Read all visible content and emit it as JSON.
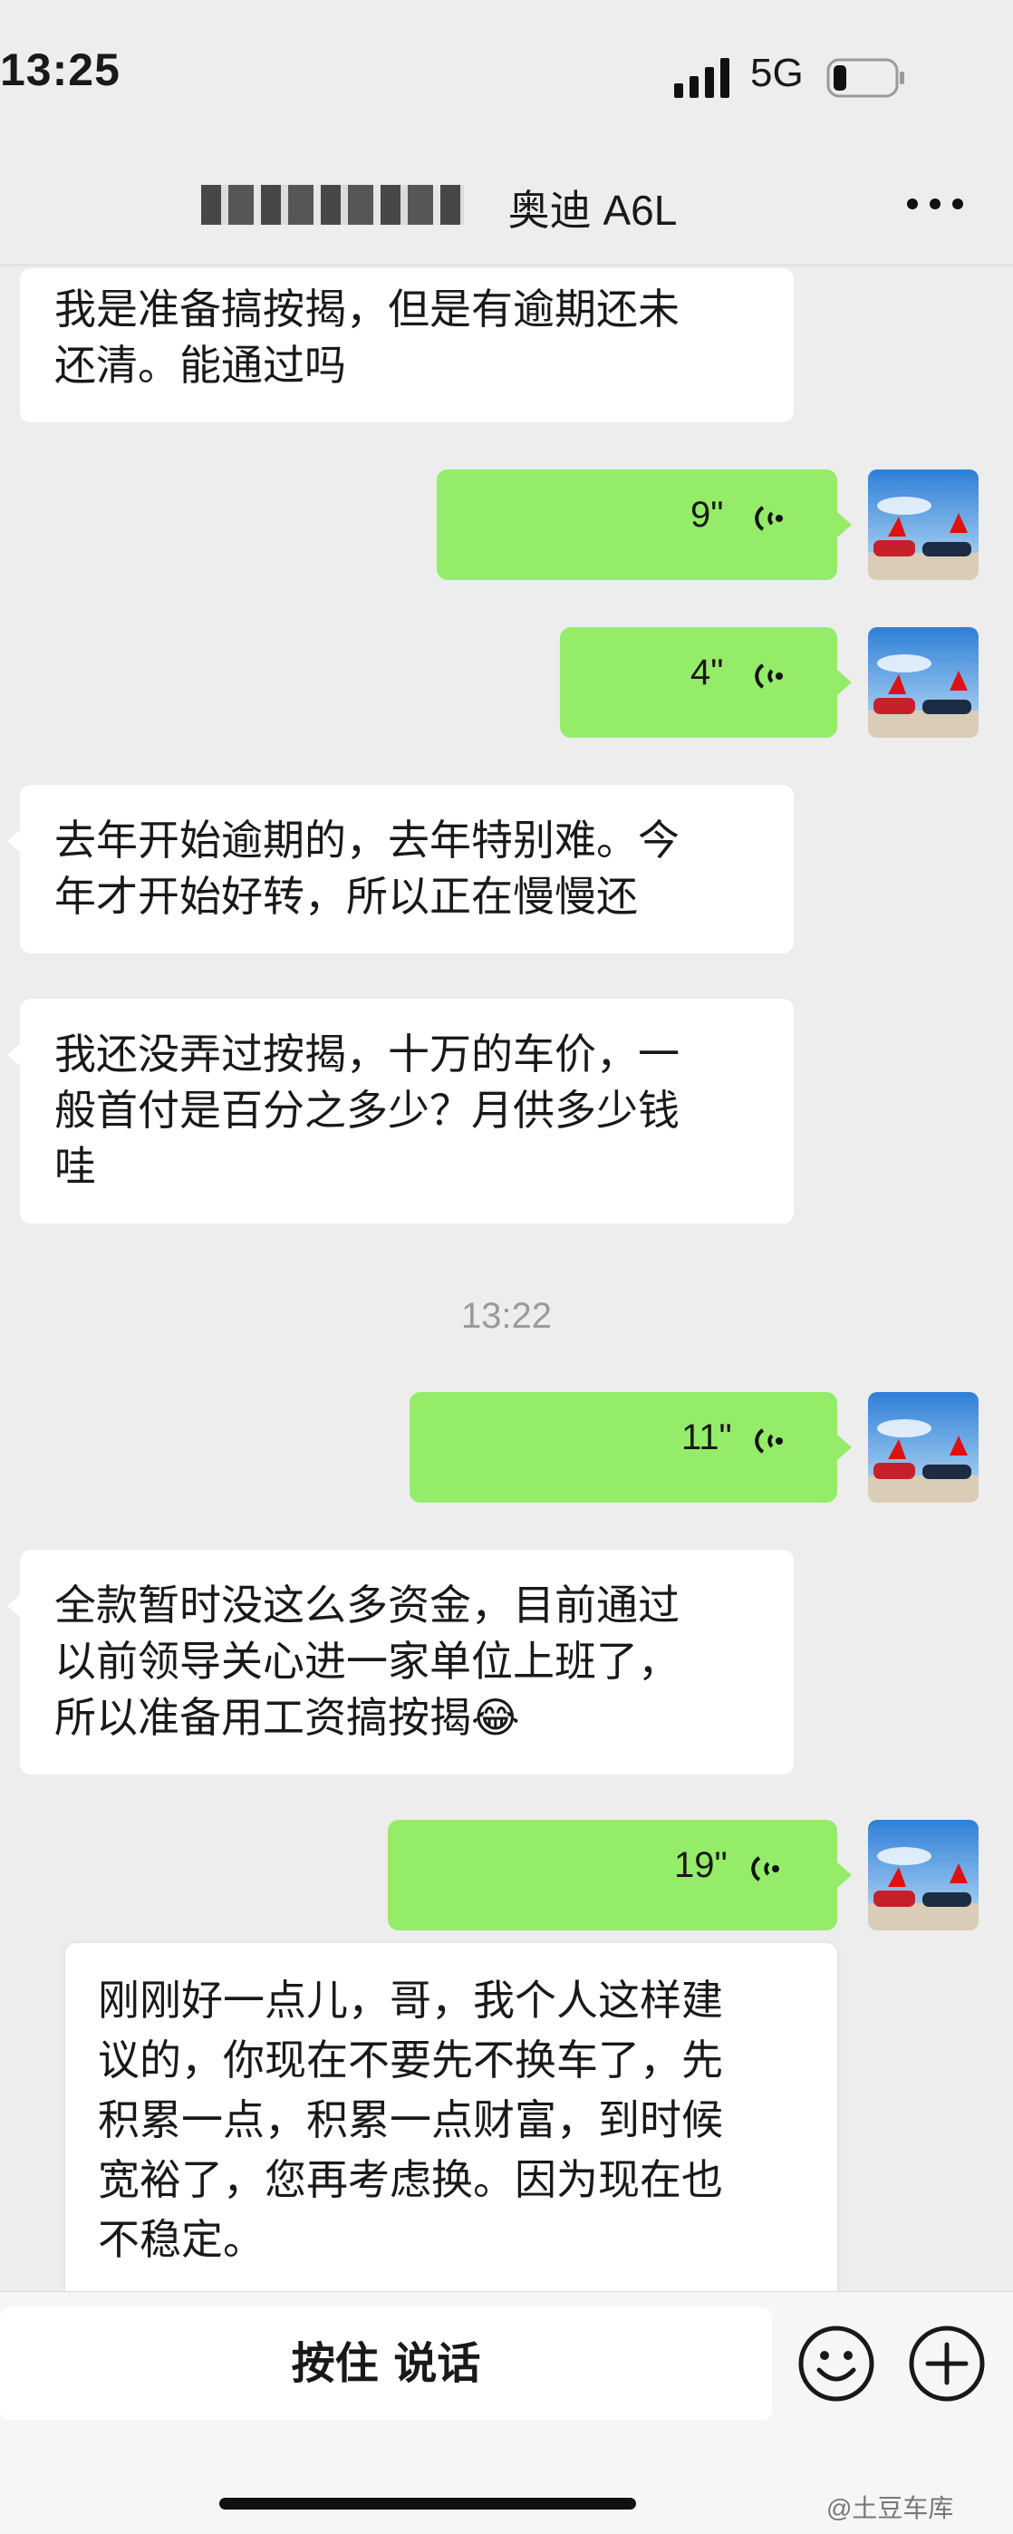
{
  "status_bar": {
    "time": "13:25",
    "network": "5G",
    "signal_icon": "signal-bars-icon",
    "battery_icon": "battery-icon"
  },
  "nav": {
    "title": "奥迪 A6L",
    "more_icon": "more-icon"
  },
  "messages": [
    {
      "type": "text",
      "side": "in",
      "lines": [
        "我是准备搞按揭，但是有逾期还未",
        "还清。能通过吗"
      ]
    },
    {
      "type": "voice",
      "side": "out",
      "duration": "9\""
    },
    {
      "type": "voice",
      "side": "out",
      "duration": "4\""
    },
    {
      "type": "text",
      "side": "in",
      "lines": [
        "去年开始逾期的，去年特别难。今",
        "年才开始好转，所以正在慢慢还"
      ]
    },
    {
      "type": "text",
      "side": "in",
      "lines": [
        "我还没弄过按揭，十万的车价，一",
        "般首付是百分之多少？月供多少钱",
        "哇"
      ]
    },
    {
      "type": "time",
      "text": "13:22"
    },
    {
      "type": "voice",
      "side": "out",
      "duration": "11\""
    },
    {
      "type": "text",
      "side": "in",
      "lines": [
        "全款暂时没这么多资金，目前通过",
        "以前领导关心进一家单位上班了，",
        "所以准备用工资搞按揭😂"
      ]
    },
    {
      "type": "voice",
      "side": "out",
      "duration": "19\""
    },
    {
      "type": "text",
      "side": "in",
      "lines": [
        "刚刚好一点儿，哥，我个人这样建",
        "议的，你现在不要先不换车了，先",
        "积累一点，积累一点财富，到时候",
        "宽裕了，您再考虑换。因为现在也",
        "不稳定。"
      ]
    }
  ],
  "input_bar": {
    "talk_label": "按住 说话",
    "emoji_icon": "emoji-icon",
    "plus_icon": "plus-icon"
  },
  "watermark": "@土豆车库",
  "colors": {
    "bg": "#ededed",
    "out_bubble": "#95ec69",
    "in_bubble": "#ffffff"
  }
}
